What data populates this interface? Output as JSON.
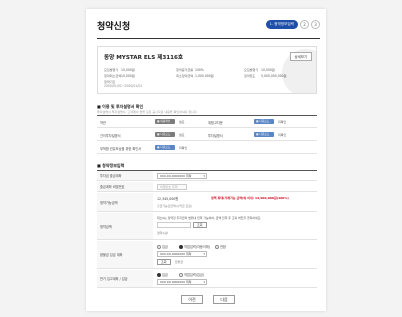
{
  "page": {
    "title": "청약신청",
    "steps": {
      "active": "1. 청약정보입력",
      "step2": "2",
      "step3": "3"
    }
  },
  "product": {
    "name": "동양 MYSTAR ELS 제3116호",
    "detail_button": "상세보기",
    "info": [
      {
        "label": "모집발행가",
        "value": "10,000원"
      },
      {
        "label": "청약증거금률",
        "value": "100%"
      },
      {
        "label": "모집발행가",
        "value": "10,000원"
      },
      {
        "label": "청약최소금액",
        "value": "10,000원"
      },
      {
        "label": "최소청약금액",
        "value": "1,000,000원"
      },
      {
        "label": "청약한도",
        "value": "5,000,000,000원"
      },
      {
        "label": "청약기간",
        "value": "2000/01/01~2000/01/01"
      }
    ]
  },
  "section1": {
    "title": "이용 및 투자설명서 확인",
    "note": "투자설명서·투자설명서, 고객께서 들을 모든 공시자료 내용을 확인하셔야 합니다.",
    "rows": [
      {
        "left": {
          "label": "약관",
          "button": "내용확인",
          "status": "필요"
        },
        "right": {
          "label": "위험고지문",
          "button": "다운로드",
          "status": "미확인"
        }
      },
      {
        "left": {
          "label": "간이투자설명서",
          "button": "다운로드",
          "status": "필요"
        },
        "right": {
          "label": "투자설명서",
          "button": "다운로드",
          "status": "미확인"
        }
      },
      {
        "left": {
          "label": "부적합 권유보상을 위한 확인서",
          "button": "다운로드",
          "status": "미확인"
        }
      }
    ]
  },
  "section2": {
    "title": "청약정보입력",
    "rows": [
      {
        "label": "투자금 출금계좌",
        "select": "000-00-0000000 위탁"
      },
      {
        "label": "출금계좌 비밀번호",
        "input": "비밀번호 입력"
      },
      {
        "label": "청약가능금액",
        "value": "12,345,000원",
        "red_text": "정책 최대(거래가능 금액)와 이내: 12,000,000원(100%)",
        "sub": "출금가능한금액(수익금 포함)"
      },
      {
        "label": "청약금액",
        "desc": "최소0는 청약한 투자금의 범위내 입력 가능하며, 금액 입력 후 조회 버튼을 클릭하세요.",
        "input": "",
        "btn": "조회",
        "sub": "청약수량"
      },
      {
        "label": "환불금 입금 계좌",
        "radios": [
          "입금",
          "직접입력(자동이체)",
          "전환"
        ],
        "select": "000-00-0000000 위탁",
        "btn": "조회",
        "sub": "환불금"
      },
      {
        "label": "만기 입고계좌 / 입금",
        "radios": [
          "입금",
          "직접입력(입금)"
        ],
        "select": "000-00-0000000 위탁"
      }
    ]
  },
  "buttons": {
    "prev": "이전",
    "next": "다음"
  }
}
